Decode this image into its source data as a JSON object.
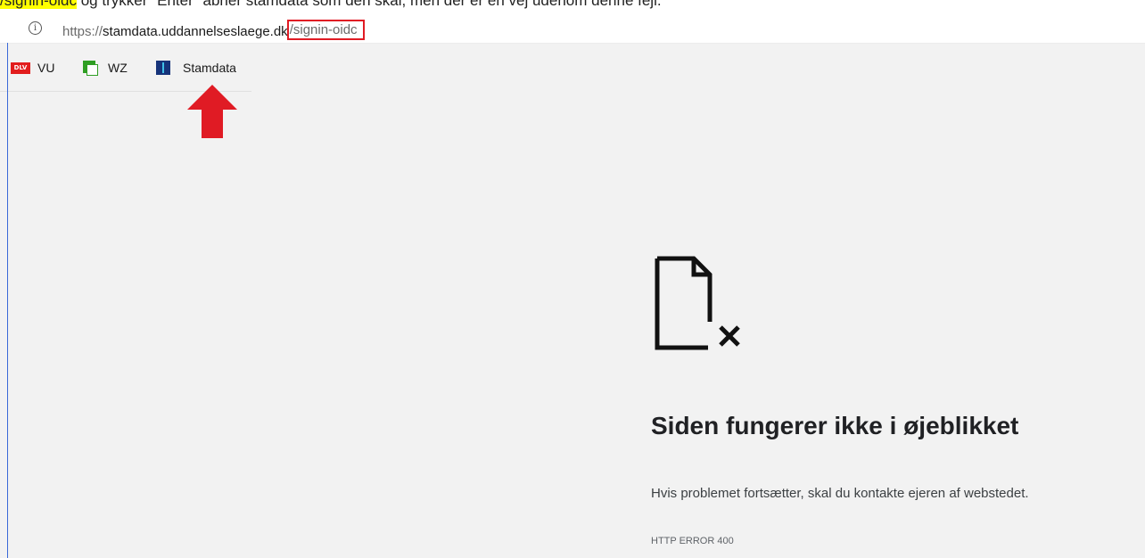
{
  "instruction": {
    "highlight": "/signin-oidc",
    "rest": " og trykker \"Enter\" åbner stamdata som den skal, men der er en vej udenom denne fejl."
  },
  "address_bar": {
    "scheme": "https://",
    "host": "stamdata.uddannelseslaege.dk",
    "path": "/signin-oidc",
    "info_icon": "info-icon"
  },
  "bookmarks": [
    {
      "label": "VU",
      "icon": "dlv-icon",
      "icon_text": "DLV"
    },
    {
      "label": "WZ",
      "icon": "wz-icon"
    },
    {
      "label": "Stamdata",
      "icon": "stamdata-icon"
    }
  ],
  "annotation": {
    "arrow_icon": "red-up-arrow-icon",
    "color": "#e01b24"
  },
  "error_page": {
    "icon": "broken-file-icon",
    "title": "Siden fungerer ikke i øjeblikket",
    "description": "Hvis problemet fortsætter, skal du kontakte ejeren af webstedet.",
    "code": "HTTP ERROR 400"
  },
  "colors": {
    "highlight": "#ffff00",
    "annotation_red": "#e01b24",
    "background": "#f2f2f2"
  }
}
